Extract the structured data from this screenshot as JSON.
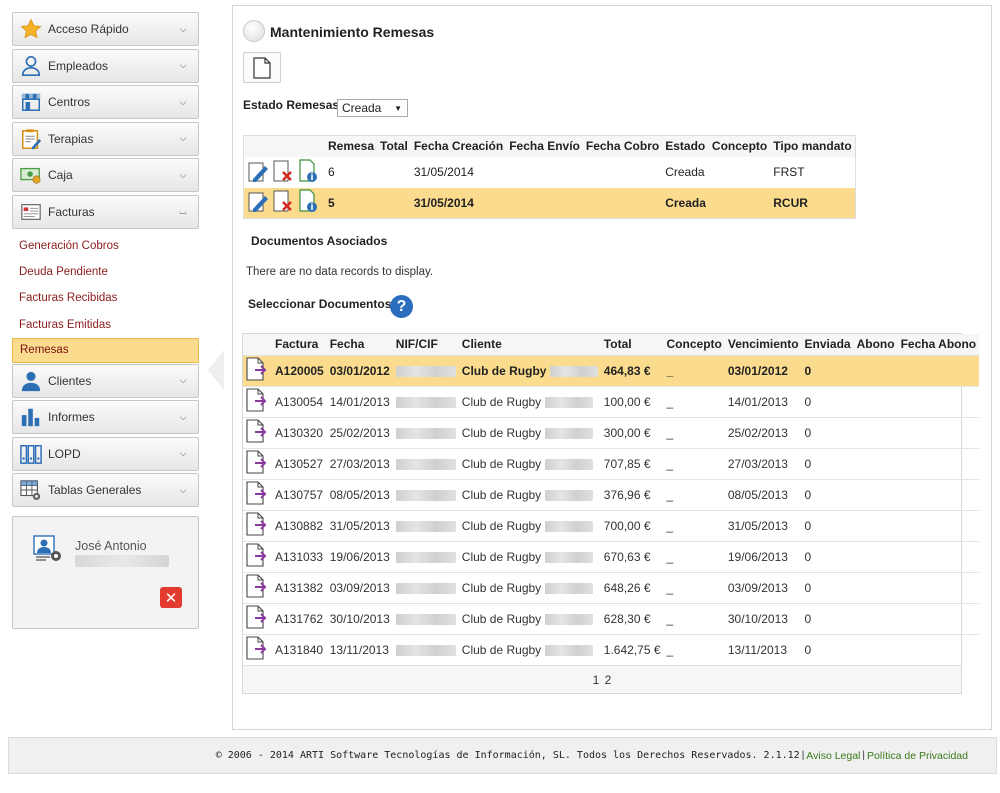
{
  "sidebar": {
    "menu": [
      {
        "label": "Acceso Rápido",
        "icon": "star-icon",
        "expanded": false
      },
      {
        "label": "Empleados",
        "icon": "employee-icon",
        "expanded": false
      },
      {
        "label": "Centros",
        "icon": "store-icon",
        "expanded": false
      },
      {
        "label": "Terapias",
        "icon": "clipboard-icon",
        "expanded": false
      },
      {
        "label": "Caja",
        "icon": "cash-icon",
        "expanded": false
      },
      {
        "label": "Facturas",
        "icon": "invoice-icon",
        "expanded": true
      },
      {
        "label": "Clientes",
        "icon": "person-icon",
        "expanded": false
      },
      {
        "label": "Informes",
        "icon": "bar-chart-icon",
        "expanded": false
      },
      {
        "label": "LOPD",
        "icon": "binders-icon",
        "expanded": false
      },
      {
        "label": "Tablas Generales",
        "icon": "table-settings-icon",
        "expanded": false
      }
    ],
    "facturas_submenu": [
      "Generación Cobros",
      "Deuda Pendiente",
      "Facturas Recibidas",
      "Facturas Emitidas",
      "Remesas"
    ],
    "active_submenu": "Remesas"
  },
  "user": {
    "name": "José Antonio"
  },
  "main": {
    "title": "Mantenimiento Remesas",
    "estado_label": "Estado Remesas",
    "estado_value": "Creada",
    "remesas": {
      "headers": [
        "",
        "Remesa",
        "Total",
        "Fecha Creación",
        "Fecha Envío",
        "Fecha Cobro",
        "Estado",
        "Concepto",
        "Tipo mandato"
      ],
      "rows": [
        {
          "remesa": "6",
          "total": "",
          "fecha_creacion": "31/05/2014",
          "fecha_envio": "",
          "fecha_cobro": "",
          "estado": "Creada",
          "concepto": "",
          "tipo_mandato": "FRST",
          "selected": false
        },
        {
          "remesa": "5",
          "total": "",
          "fecha_creacion": "31/05/2014",
          "fecha_envio": "",
          "fecha_cobro": "",
          "estado": "Creada",
          "concepto": "",
          "tipo_mandato": "RCUR",
          "selected": true
        }
      ]
    },
    "docs_asociados_label": "Documentos Asociados",
    "no_records": "There are no data records to display.",
    "seleccionar_label": "Seleccionar Documentos",
    "documentos": {
      "headers": [
        "",
        "Factura",
        "Fecha",
        "NIF/CIF",
        "Cliente",
        "Total",
        "Concepto",
        "Vencimiento",
        "Enviada",
        "Abono",
        "Fecha Abono"
      ],
      "rows": [
        {
          "factura": "A120005",
          "fecha": "03/01/2012",
          "cliente": "Club de Rugby",
          "total": "464,83 €",
          "concepto": "_",
          "vencimiento": "03/01/2012",
          "enviada": "0",
          "selected": true
        },
        {
          "factura": "A130054",
          "fecha": "14/01/2013",
          "cliente": "Club de Rugby",
          "total": "100,00 €",
          "concepto": "_",
          "vencimiento": "14/01/2013",
          "enviada": "0",
          "selected": false
        },
        {
          "factura": "A130320",
          "fecha": "25/02/2013",
          "cliente": "Club de Rugby",
          "total": "300,00 €",
          "concepto": "_",
          "vencimiento": "25/02/2013",
          "enviada": "0",
          "selected": false
        },
        {
          "factura": "A130527",
          "fecha": "27/03/2013",
          "cliente": "Club de Rugby",
          "total": "707,85 €",
          "concepto": "_",
          "vencimiento": "27/03/2013",
          "enviada": "0",
          "selected": false
        },
        {
          "factura": "A130757",
          "fecha": "08/05/2013",
          "cliente": "Club de Rugby",
          "total": "376,96 €",
          "concepto": "_",
          "vencimiento": "08/05/2013",
          "enviada": "0",
          "selected": false
        },
        {
          "factura": "A130882",
          "fecha": "31/05/2013",
          "cliente": "Club de Rugby",
          "total": "700,00 €",
          "concepto": "_",
          "vencimiento": "31/05/2013",
          "enviada": "0",
          "selected": false
        },
        {
          "factura": "A131033",
          "fecha": "19/06/2013",
          "cliente": "Club de Rugby",
          "total": "670,63 €",
          "concepto": "_",
          "vencimiento": "19/06/2013",
          "enviada": "0",
          "selected": false
        },
        {
          "factura": "A131382",
          "fecha": "03/09/2013",
          "cliente": "Club de Rugby",
          "total": "648,26 €",
          "concepto": "_",
          "vencimiento": "03/09/2013",
          "enviada": "0",
          "selected": false
        },
        {
          "factura": "A131762",
          "fecha": "30/10/2013",
          "cliente": "Club de Rugby",
          "total": "628,30 €",
          "concepto": "_",
          "vencimiento": "30/10/2013",
          "enviada": "0",
          "selected": false
        },
        {
          "factura": "A131840",
          "fecha": "13/11/2013",
          "cliente": "Club de Rugby",
          "total": "1.642,75 €",
          "concepto": "_",
          "vencimiento": "13/11/2013",
          "enviada": "0",
          "selected": false
        }
      ],
      "pages": [
        "1",
        "2"
      ]
    }
  },
  "footer": {
    "copyright": "© 2006 - 2014 ARTI Software Tecnologías de Información, SL. Todos los Derechos Reservados. 2.1.12",
    "aviso_legal": "Aviso Legal",
    "privacidad": "Política de Privacidad",
    "separator": "|"
  },
  "colors": {
    "selected_row": "#fbdc8e",
    "submenu_link": "#8b1c1c",
    "footer_link": "#3a7a1a",
    "help_icon": "#2a6ebd",
    "logout_button": "#e33b2f"
  }
}
